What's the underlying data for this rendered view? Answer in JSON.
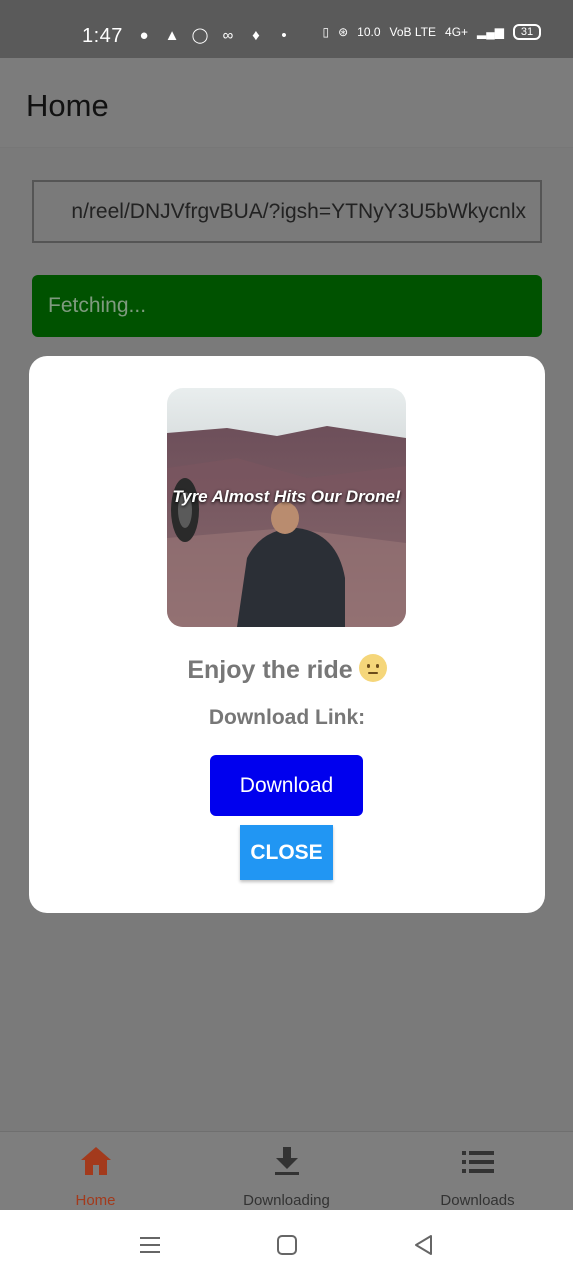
{
  "status_bar": {
    "time": "1:47",
    "network_speed": "10.0",
    "network_unit": "KB/S",
    "carrier": "VoB LTE",
    "signal": "4G+",
    "battery": "31"
  },
  "app_bar": {
    "title": "Home"
  },
  "url_input": {
    "value": "n/reel/DNJVfrgvBUA/?igsh=YTNyY3U5bWkycnlx"
  },
  "fetch_button": {
    "label": "Fetching..."
  },
  "modal": {
    "thumbnail_caption": "Tyre Almost Hits Our Drone!",
    "title": "Enjoy the ride",
    "download_link_label": "Download Link:",
    "download_button": "Download",
    "close_button": "CLOSE"
  },
  "bottom_nav": {
    "items": [
      {
        "label": "Home",
        "icon": "home-icon",
        "active": true
      },
      {
        "label": "Downloading",
        "icon": "download-icon",
        "active": false
      },
      {
        "label": "Downloads",
        "icon": "list-icon",
        "active": false
      }
    ]
  },
  "colors": {
    "fetch_button": "#005200",
    "download_button": "#0000ee",
    "close_button": "#2196f3",
    "nav_active": "#a33a1c"
  }
}
